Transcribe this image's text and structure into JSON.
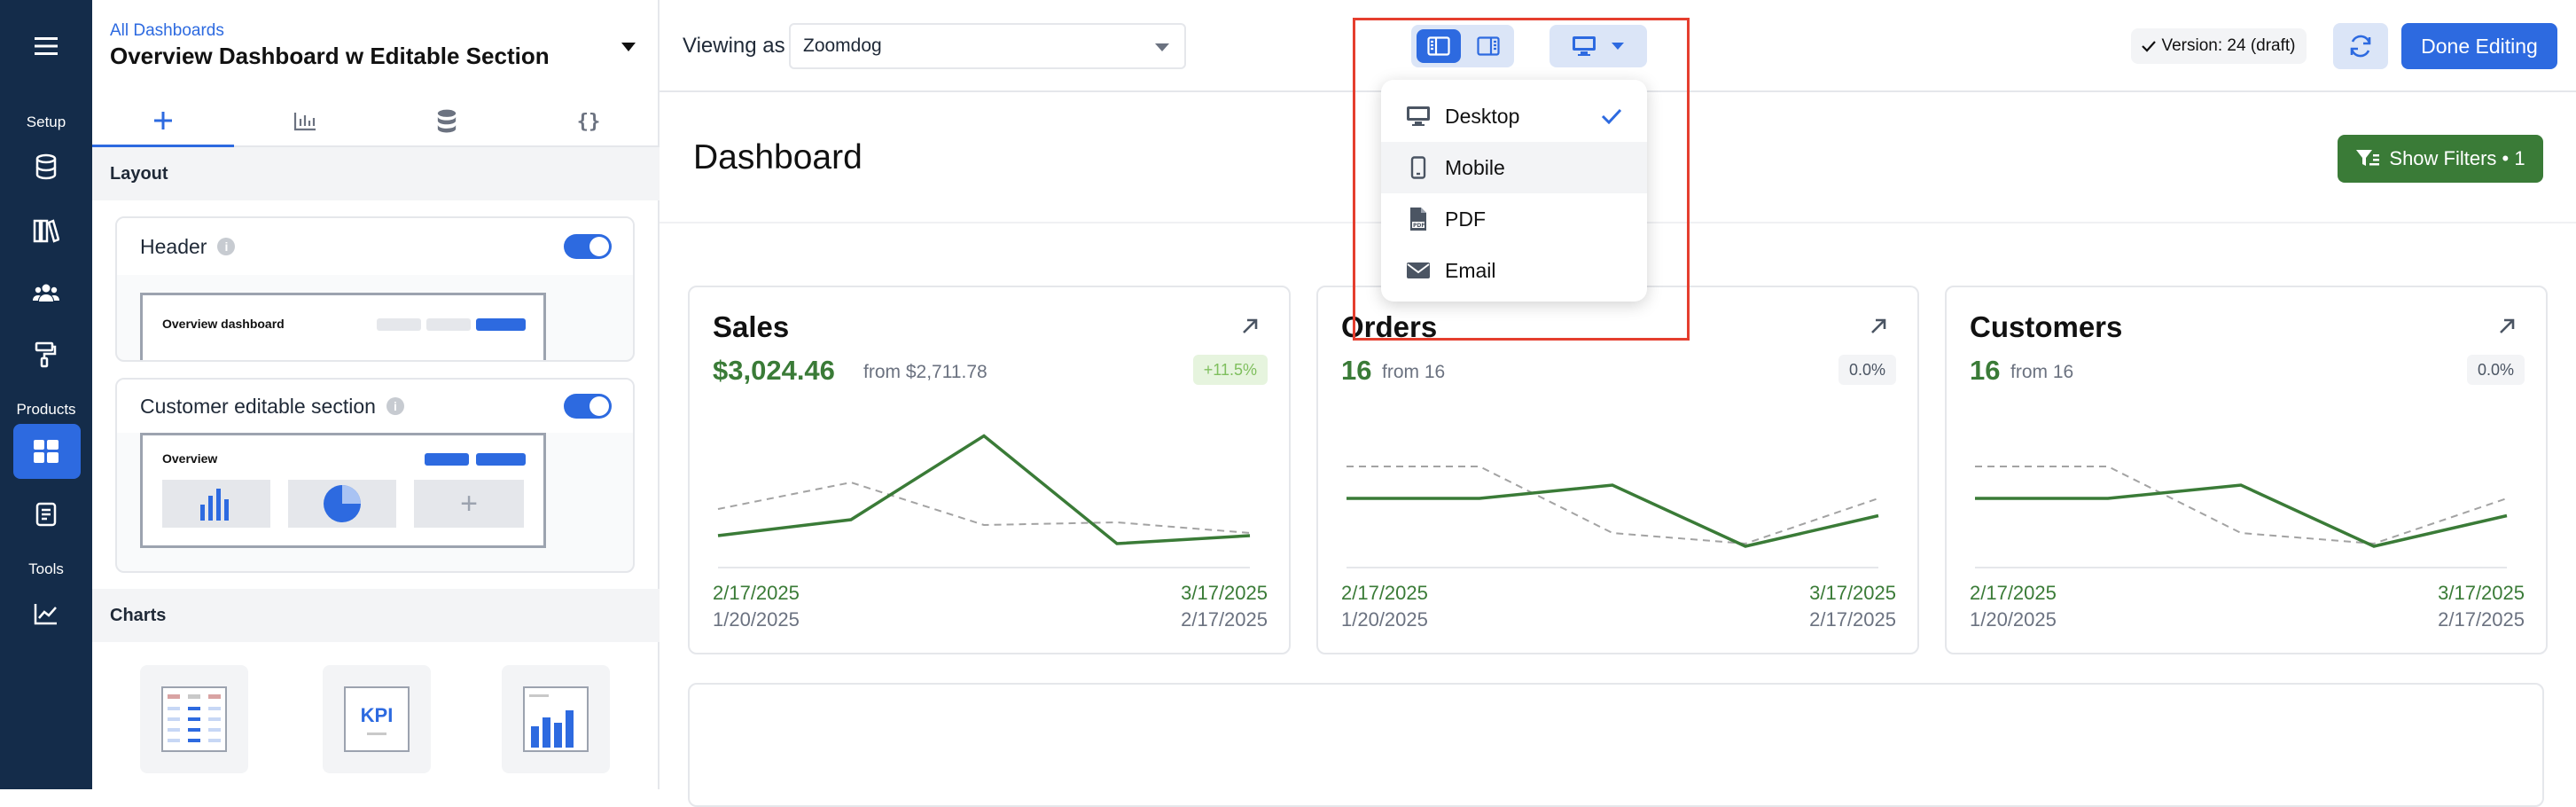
{
  "rail": {
    "sections": [
      "Setup",
      "Products",
      "Tools"
    ]
  },
  "panel": {
    "breadcrumb": "All Dashboards",
    "title": "Overview Dashboard w Editable Section",
    "layout_label": "Layout",
    "header_card": {
      "label": "Header",
      "thumb_title": "Overview dashboard"
    },
    "editable_card": {
      "label": "Customer editable section",
      "thumb_title": "Overview"
    },
    "charts_label": "Charts",
    "kpi_tile": "KPI"
  },
  "topbar": {
    "viewing_as_label": "Viewing as",
    "viewing_as_value": "Zoomdog",
    "version": "Version: 24 (draft)",
    "done_editing": "Done Editing"
  },
  "device_menu": {
    "items": [
      {
        "label": "Desktop",
        "icon": "desktop-icon",
        "selected": true
      },
      {
        "label": "Mobile",
        "icon": "mobile-icon",
        "selected": false
      },
      {
        "label": "PDF",
        "icon": "pdf-icon",
        "selected": false
      },
      {
        "label": "Email",
        "icon": "email-icon",
        "selected": false
      }
    ]
  },
  "dashboard": {
    "title": "Dashboard",
    "show_filters": "Show Filters • 1",
    "kpis": [
      {
        "title": "Sales",
        "value": "$3,024.46",
        "from": "from $2,711.78",
        "change": "+11.5%",
        "current_start": "2/17/2025",
        "current_end": "3/17/2025",
        "prev_start": "1/20/2025",
        "prev_end": "2/17/2025",
        "current_series": [
          0.2,
          0.32,
          0.95,
          0.14,
          0.2
        ],
        "previous_series": [
          0.4,
          0.6,
          0.28,
          0.3,
          0.22
        ]
      },
      {
        "title": "Orders",
        "value": "16",
        "from": "from 16",
        "change": "0.0%",
        "current_start": "2/17/2025",
        "current_end": "3/17/2025",
        "prev_start": "1/20/2025",
        "prev_end": "2/17/2025",
        "current_series": [
          0.48,
          0.48,
          0.58,
          0.12,
          0.35
        ],
        "previous_series": [
          0.72,
          0.72,
          0.22,
          0.14,
          0.48
        ]
      },
      {
        "title": "Customers",
        "value": "16",
        "from": "from 16",
        "change": "0.0%",
        "current_start": "2/17/2025",
        "current_end": "3/17/2025",
        "prev_start": "1/20/2025",
        "prev_end": "2/17/2025",
        "current_series": [
          0.48,
          0.48,
          0.58,
          0.12,
          0.35
        ],
        "previous_series": [
          0.72,
          0.72,
          0.22,
          0.14,
          0.48
        ]
      }
    ]
  },
  "colors": {
    "rail": "#142c4a",
    "primary": "#2d6ae0",
    "positive": "#3a7b37",
    "highlight": "#e53e2e"
  }
}
